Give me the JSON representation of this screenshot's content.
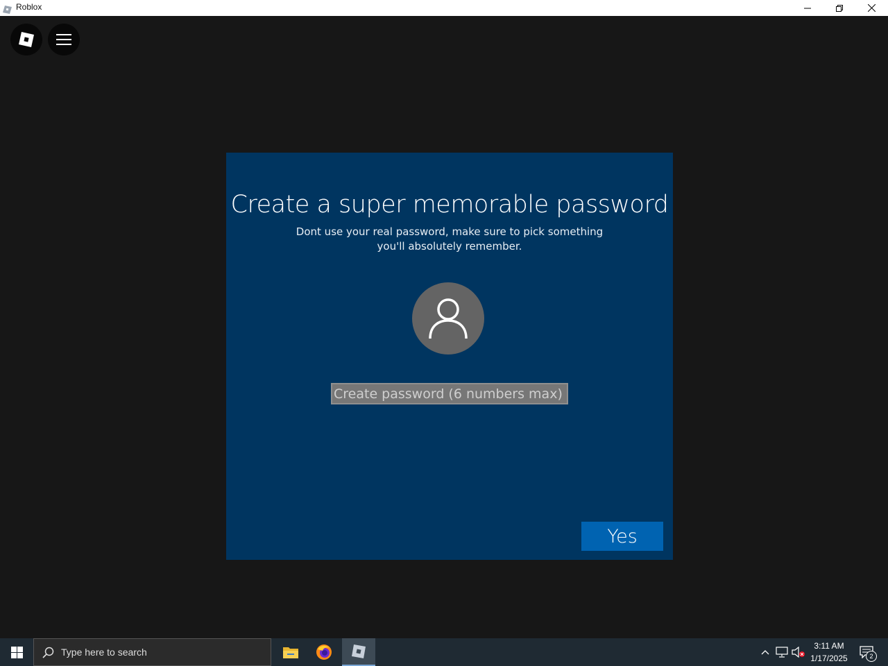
{
  "window": {
    "title": "Roblox"
  },
  "dialog": {
    "title": "Create a super memorable password",
    "subtitle": "Dont use your real password, make sure to pick something you'll absolutely remember.",
    "password_placeholder": "Create password (6 numbers max)",
    "yes_label": "Yes"
  },
  "taskbar": {
    "search_placeholder": "Type here to search",
    "time": "3:11 AM",
    "date": "1/17/2025",
    "notification_count": "2"
  },
  "icons": {
    "roblox_logo": "roblox-logo-icon",
    "menu": "hamburger-menu-icon",
    "user": "user-icon",
    "start": "windows-start-icon",
    "search": "search-icon",
    "explorer": "file-explorer-icon",
    "firefox": "firefox-icon",
    "roblox_app": "roblox-app-icon"
  },
  "colors": {
    "dialog_bg": "#003560",
    "yes_button": "#0063b1",
    "game_bg": "#171717",
    "taskbar_bg": "#1f2a33"
  }
}
